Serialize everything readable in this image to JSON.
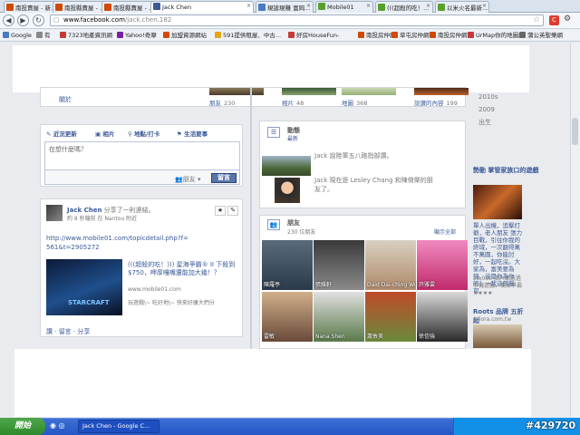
{
  "browser": {
    "tabs": [
      {
        "label": "南投賣屋 - 新...",
        "icon_color": "#d04a02",
        "active": false
      },
      {
        "label": "南投縣賣屋 - ...",
        "icon_color": "#d04a02",
        "active": false
      },
      {
        "label": "南投縣賣屋 - ...",
        "icon_color": "#d04a02",
        "active": false
      },
      {
        "label": "Jack Chen",
        "icon_color": "#3b5998",
        "active": true
      },
      {
        "label": "現搶現賺 富岡...",
        "icon_color": "#4a7ac2",
        "active": false
      },
      {
        "label": "Mobile01",
        "icon_color": "#5aa02c",
        "active": false
      },
      {
        "label": "(((超殺的吃！...",
        "icon_color": "#5aa02c",
        "active": false
      },
      {
        "label": "以米火名最新...",
        "icon_color": "#5aa02c",
        "active": false
      }
    ],
    "url_host": "www.facebook.com",
    "url_path": "/jack.chen.182",
    "bookmarks": [
      {
        "label": "Google",
        "color": "#4a7ac2"
      },
      {
        "label": "有",
        "color": "#888888"
      },
      {
        "label": "7323地產資訊網",
        "color": "#c43a3a"
      },
      {
        "label": "Yahoo!奇摩",
        "color": "#7b1fa2"
      },
      {
        "label": "加盟資源網站",
        "color": "#d04a02"
      },
      {
        "label": "591提供租屋、中古...",
        "color": "#e8a317"
      },
      {
        "label": "好房HouseFun-",
        "color": "#c43a3a"
      },
      {
        "label": "南投房仲網",
        "color": "#d04a02"
      },
      {
        "label": "草屯房仲網",
        "color": "#d04a02"
      },
      {
        "label": "南投房仲網",
        "color": "#d04a02"
      },
      {
        "label": "UrMap你的地圖網",
        "color": "#c43a3a"
      },
      {
        "label": "蒲公英聖樂網",
        "color": "#666666"
      }
    ]
  },
  "profile_strip": {
    "left_label": "關於",
    "stats": [
      {
        "label": "朋友",
        "count": "230"
      },
      {
        "label": "相片",
        "count": "48"
      },
      {
        "label": "地圖",
        "count": "368"
      },
      {
        "label": "說讚的內容",
        "count": "199"
      }
    ]
  },
  "composer": {
    "tabs": [
      "近況更新",
      "相片",
      "地點/打卡",
      "生活要事"
    ],
    "placeholder": "在想什麼嗎？",
    "audience": "朋友",
    "submit": "留言"
  },
  "post": {
    "author": "Jack Chen",
    "action": "分享了一則連結。",
    "meta": "約 8 秒鐘前 在 Nantou 附近",
    "url": "http://www.mobile01.com/topicdetail.php?f=561&t=2905272",
    "link_title": "(((超殺的吃！))) 星海爭霸® II 下殺到$750，呷厚嘎嘴還能加大幾！？",
    "link_domain": "www.mobile01.com",
    "link_desc": "玩遊戲\\~ 吃好地\\~ 快來好康大們分",
    "actions": [
      "讚",
      "留言",
      "分享"
    ]
  },
  "activity": {
    "title": "動態",
    "subtitle": "最新",
    "items": [
      "Jack 說陸軍五八砲指部讚。",
      "Jack 現在是 Lesley Chang 和陳倚樂的朋友了。"
    ]
  },
  "friends": {
    "title": "朋友",
    "count": "230 位朋友",
    "see_all": "顯示全部",
    "names": [
      "陳羅亭",
      "張維軒",
      "Daid Dai-ching Wu",
      "許雅雲",
      "雷敏",
      "Nana Shen",
      "蕭敦美",
      "徐信強"
    ]
  },
  "rightcol": {
    "years": [
      "2010s",
      "2009",
      "出生"
    ],
    "ad1_title": "勢動 掌管家族口的遊戲",
    "ad1_domain": "apps.facebook.com",
    "ad1_text": "單人出機，追擊打爺，老人朋友 張力目戰，引往你我的終域，一次翻得萬不萬圓，你能討好，一起吃沒。大家為，富美要為錢，這是你為你的！一我這個嚴可，",
    "ad1_stats": "30,000 個人都玩過手機遊戲，美女爭霸★★★★",
    "ad2_title": "Roots 品牌 五折起",
    "ad2_domain": "zalora.com.tw"
  },
  "taskbar": {
    "start": "開始",
    "window": "Jack Chen - Google C..."
  },
  "watermark": "#429720"
}
